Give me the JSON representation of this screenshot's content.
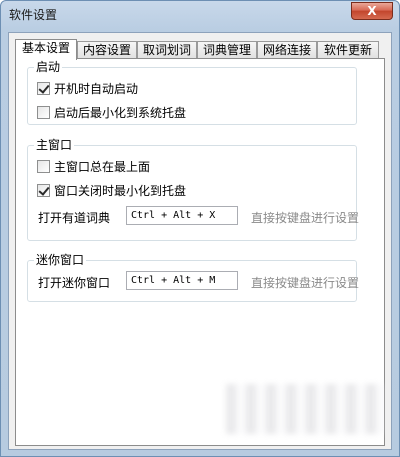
{
  "window": {
    "title": "软件设置",
    "close_label": "X"
  },
  "tabs": [
    {
      "label": "基本设置",
      "active": true
    },
    {
      "label": "内容设置",
      "active": false
    },
    {
      "label": "取词划词",
      "active": false
    },
    {
      "label": "词典管理",
      "active": false
    },
    {
      "label": "网络连接",
      "active": false
    },
    {
      "label": "软件更新",
      "active": false
    }
  ],
  "startup": {
    "title": "启动",
    "auto_start": {
      "label": "开机时自动启动",
      "checked": true
    },
    "minimize_tray": {
      "label": "启动后最小化到系统托盘",
      "checked": false
    }
  },
  "main_window": {
    "title": "主窗口",
    "always_on_top": {
      "label": "主窗口总在最上面",
      "checked": false
    },
    "close_to_tray": {
      "label": "窗口关闭时最小化到托盘",
      "checked": true
    },
    "hotkey_label": "打开有道词典",
    "hotkey_value": "Ctrl + Alt + X",
    "hotkey_hint": "直接按键盘进行设置"
  },
  "mini_window": {
    "title": "迷你窗口",
    "hotkey_label": "打开迷你窗口",
    "hotkey_value": "Ctrl + Alt + M",
    "hotkey_hint": "直接按键盘进行设置"
  }
}
